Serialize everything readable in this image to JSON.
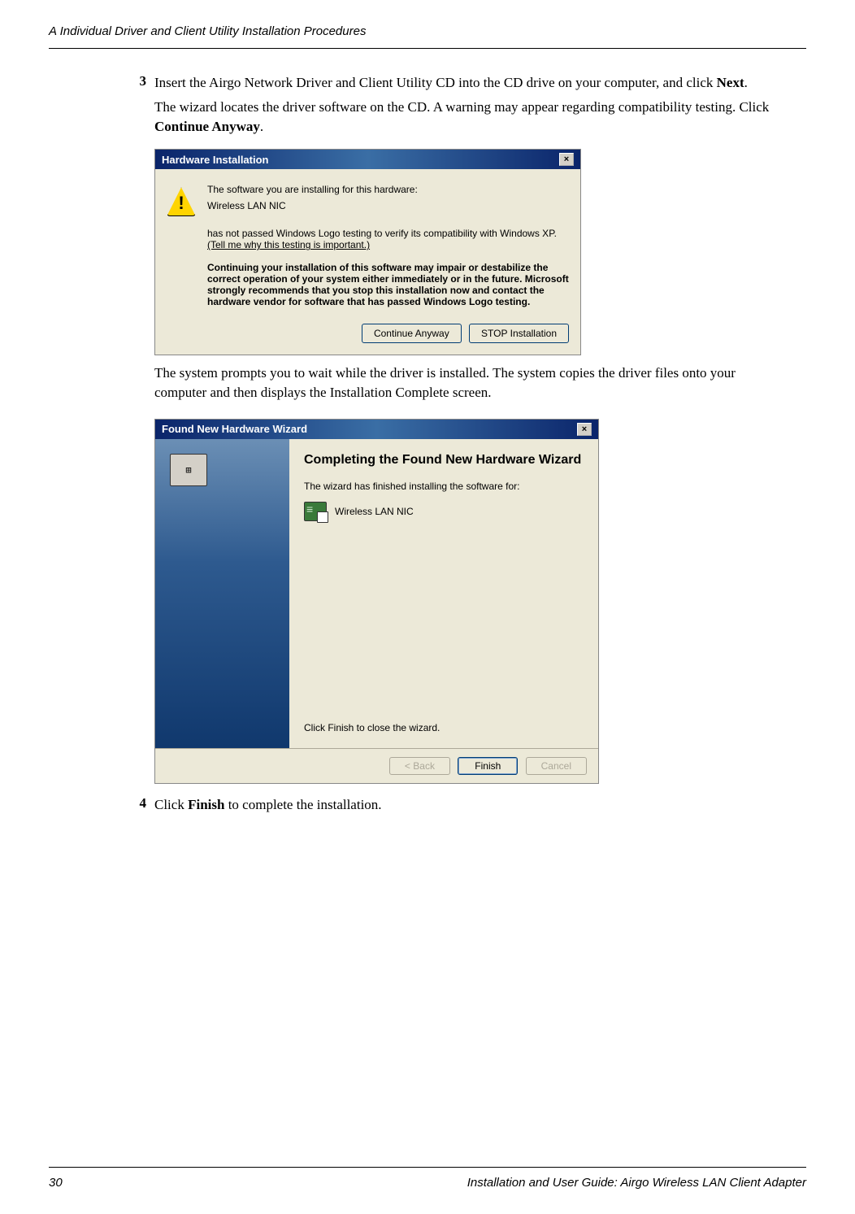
{
  "header": {
    "left": "A  Individual Driver and Client Utility Installation Procedures",
    "right": ""
  },
  "steps": {
    "s3": {
      "num": "3",
      "text_1": "Insert the Airgo Network Driver and Client Utility CD into the CD drive on your computer, and click ",
      "bold_1": "Next",
      "text_2": ".",
      "para_1": "The wizard locates the driver software on the CD. A warning may appear regarding compatibility testing. Click ",
      "para_bold": "Continue Anyway",
      "para_2": "."
    },
    "s4": {
      "num": "4",
      "text_1": "Click ",
      "bold_1": "Finish",
      "text_2": " to complete the installation."
    }
  },
  "between_para": "The system prompts you to wait while the driver is installed. The system copies the driver files onto your computer and then displays the Installation Complete screen.",
  "dialog1": {
    "title": "Hardware Installation",
    "line1": "The software you are installing for this hardware:",
    "device": "Wireless LAN NIC",
    "line2_a": "has not passed Windows Logo testing to verify its compatibility with Windows XP. ",
    "line2_link": "(Tell me why this testing is important.)",
    "bold_text": "Continuing your installation of this software may impair or destabilize the correct operation of your system either immediately or in the future. Microsoft strongly recommends that you stop this installation now and contact the hardware vendor for software that has passed Windows Logo testing.",
    "btn_continue": "Continue Anyway",
    "btn_stop": "STOP Installation"
  },
  "dialog2": {
    "title": "Found New Hardware Wizard",
    "heading": "Completing the Found New Hardware Wizard",
    "line1": "The wizard has finished installing the software for:",
    "device": "Wireless LAN NIC",
    "line2": "Click Finish to close the wizard.",
    "btn_back": "< Back",
    "btn_finish": "Finish",
    "btn_cancel": "Cancel"
  },
  "footer": {
    "page": "30",
    "right": "Installation and User Guide: Airgo Wireless LAN Client Adapter"
  }
}
